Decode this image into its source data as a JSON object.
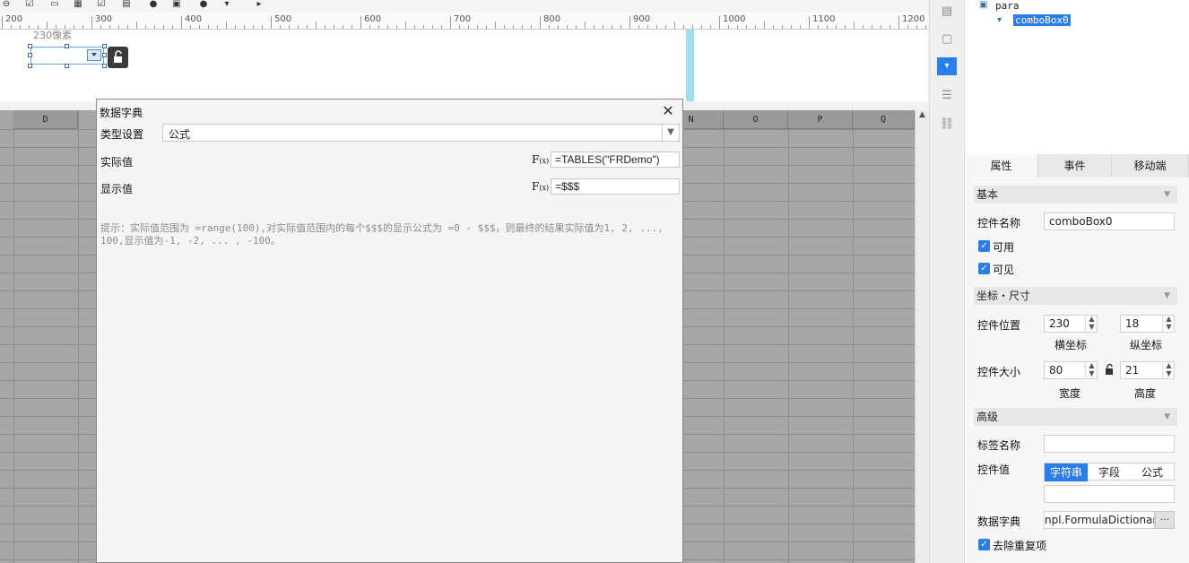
{
  "ruler": {
    "labels": [
      "200",
      "300",
      "400",
      "500",
      "600",
      "700",
      "800",
      "900",
      "1000",
      "1100",
      "1200"
    ]
  },
  "para": {
    "pixel_label": "230像素"
  },
  "grid": {
    "columns": [
      "D",
      "N",
      "O",
      "P",
      "Q"
    ]
  },
  "dialog": {
    "title": "数据字典",
    "type_label": "类型设置",
    "type_value": "公式",
    "actual_label": "实际值",
    "actual_value": "=TABLES(\"FRDemo\")",
    "display_label": "显示值",
    "display_value": "=$$$",
    "fx_icon": "F(x)",
    "hint": "提示：实际值范围为 =range(100),对实际值范围内的每个$$$的显示公式为 =0 - $$$，则最终的结果实际值为1, 2, ..., 100,显示值为-1, -2, ... , -100。"
  },
  "tree": {
    "root": "para",
    "child": "comboBox0"
  },
  "tabs": [
    "属性",
    "事件",
    "移动端"
  ],
  "props": {
    "basic_section": "基本",
    "name_label": "控件名称",
    "name_value": "comboBox0",
    "enabled_label": "可用",
    "visible_label": "可见",
    "coord_section": "坐标・尺寸",
    "position_label": "控件位置",
    "x_value": "230",
    "y_value": "18",
    "x_caption": "横坐标",
    "y_caption": "纵坐标",
    "size_label": "控件大小",
    "width_value": "80",
    "height_value": "21",
    "width_caption": "宽度",
    "height_caption": "高度",
    "advanced_section": "高级",
    "tag_label": "标签名称",
    "value_label": "控件值",
    "value_types": [
      "字符串",
      "字段",
      "公式"
    ],
    "dict_label": "数据字典",
    "dict_value": "npl.FormulaDictionary",
    "dict_btn": "···",
    "dedupe_label": "去除重复项"
  },
  "colors": {
    "accent": "#2b7de9",
    "selection": "#5b8fc9",
    "para_strip": "#9fdfee",
    "grid": "#a6a6a6"
  }
}
